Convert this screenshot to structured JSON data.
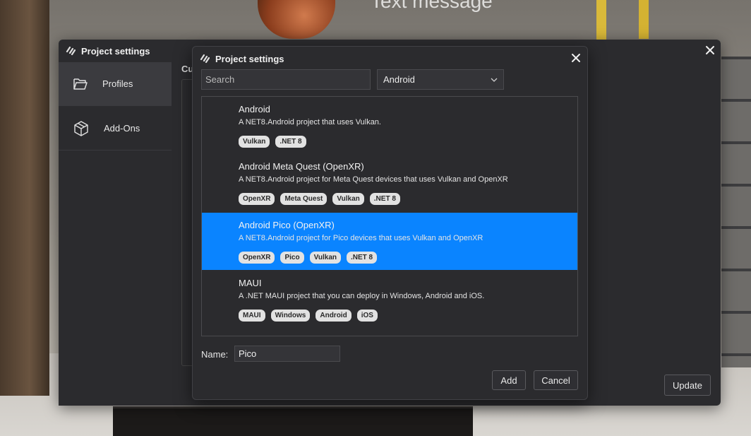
{
  "scene": {
    "title_ghost": "Text message"
  },
  "back_dialog": {
    "title": "Project settings",
    "sidebar": [
      {
        "label": "Profiles",
        "icon": "folder-icon",
        "active": true
      },
      {
        "label": "Add-Ons",
        "icon": "cube-icon",
        "active": false
      }
    ],
    "content_heading": "Cu",
    "update_label": "Update"
  },
  "dialog": {
    "title": "Project settings",
    "search_placeholder": "Search",
    "platform_selected": "Android",
    "templates": [
      {
        "title": "Android",
        "description": "A NET8.Android project that uses Vulkan.",
        "tags": [
          "Vulkan",
          ".NET 8"
        ],
        "selected": false
      },
      {
        "title": "Android Meta Quest (OpenXR)",
        "description": "A NET8.Android project for Meta Quest devices that uses Vulkan and OpenXR",
        "tags": [
          "OpenXR",
          "Meta Quest",
          "Vulkan",
          ".NET 8"
        ],
        "selected": false
      },
      {
        "title": "Android Pico (OpenXR)",
        "description": "A NET8.Android project for Pico devices that uses Vulkan and OpenXR",
        "tags": [
          "OpenXR",
          "Pico",
          "Vulkan",
          ".NET 8"
        ],
        "selected": true
      },
      {
        "title": "MAUI",
        "description": "A .NET MAUI project that you can deploy in Windows, Android and iOS.",
        "tags": [
          "MAUI",
          "Windows",
          "Android",
          "iOS"
        ],
        "selected": false
      }
    ],
    "name_label": "Name:",
    "name_value": "Pico",
    "add_label": "Add",
    "cancel_label": "Cancel"
  },
  "colors": {
    "accent": "#0a84ff",
    "dialog_bg": "#2b2b2e",
    "tag_bg": "#e2e2e2"
  }
}
